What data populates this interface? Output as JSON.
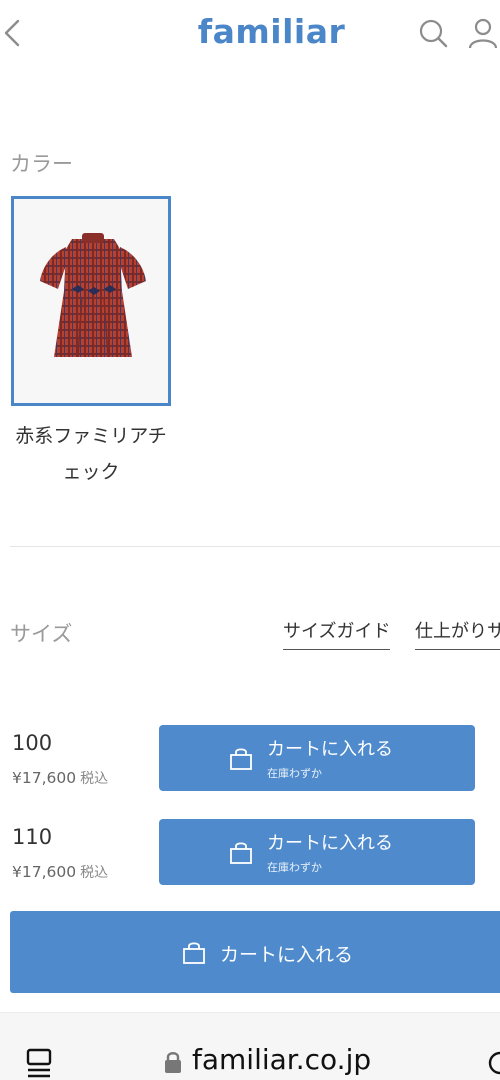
{
  "header": {
    "logo": "familiar",
    "icons": [
      "back-icon",
      "search-icon",
      "user-icon"
    ],
    "brand_color": "#4a86c8"
  },
  "color_section": {
    "label": "カラー",
    "swatch": {
      "name": "赤系ファミリアチェック",
      "icon": "dress-thumbnail"
    }
  },
  "size_section": {
    "label": "サイズ",
    "links": {
      "size_guide": "サイズガイド",
      "finish_size": "仕上がりサ"
    },
    "rows": [
      {
        "size": "100",
        "price": "¥17,600",
        "tax": "税込",
        "button": "カートに入れる",
        "stock": "在庫わずか"
      },
      {
        "size": "110",
        "price": "¥17,600",
        "tax": "税込",
        "button": "カートに入れる",
        "stock": "在庫わずか"
      }
    ]
  },
  "main_cart": {
    "label": "カートに入れる"
  },
  "browser": {
    "url": "familiar.co.jp",
    "icons": [
      "tabs-icon",
      "lock-icon",
      "reload-icon"
    ]
  },
  "colors": {
    "button": "#4f8bcc",
    "selected_border": "#4a86c8",
    "label_grey": "#9a9a9a"
  }
}
